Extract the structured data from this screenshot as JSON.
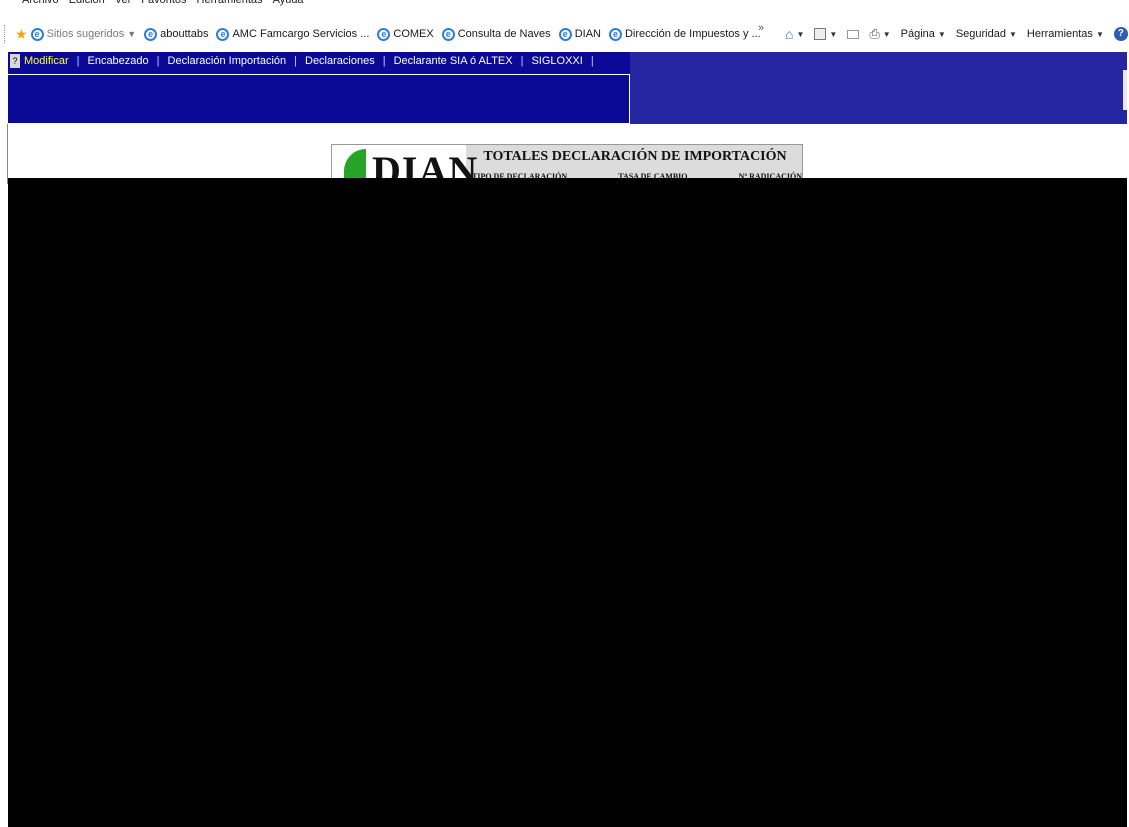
{
  "menu": [
    "Archivo",
    "Edición",
    "Ver",
    "Favoritos",
    "Herramientas",
    "Ayuda"
  ],
  "favorites": {
    "suggested": "Sitios sugeridos",
    "items": [
      "abouttabs",
      "AMC Famcargo Servicios ...",
      "COMEX",
      "Consulta de Naves",
      "DIAN",
      "Dirección de Impuestos y ..."
    ],
    "overflow": "»"
  },
  "commandbar": {
    "page": "Página",
    "security": "Seguridad",
    "tools": "Herramientas"
  },
  "appnav": {
    "help": "?",
    "items": [
      "Modificar",
      "Encabezado",
      "Declaración Importación",
      "Declaraciones",
      "Declarante SIA ó ALTEX",
      "SIGLOXXI"
    ],
    "separator": "|"
  },
  "header": {
    "logo": "DIAN",
    "title": "TOTALES DECLARACIÓN DE IMPORTACIÓN",
    "labels": [
      "TIPO DE DECLARACIÓN",
      "TASA DE CAMBIO",
      "Nº RADICACIÓN"
    ]
  },
  "colors": {
    "nav_dark": "#0a0a96",
    "nav_light": "#2626a0",
    "active": "#ffff33",
    "logo_green": "#27a327"
  }
}
